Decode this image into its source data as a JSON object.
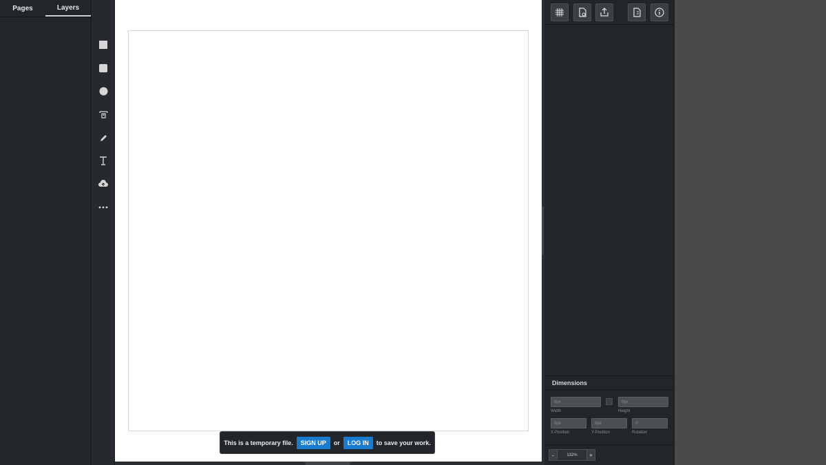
{
  "left_panel": {
    "tabs": [
      {
        "label": "Pages",
        "active": false
      },
      {
        "label": "Layers",
        "active": true
      }
    ]
  },
  "toolbar": {
    "tools": [
      "rectangle-icon",
      "rounded-rectangle-icon",
      "ellipse-icon",
      "image-icon",
      "pencil-icon",
      "text-icon",
      "upload-cloud-icon",
      "more-icon"
    ]
  },
  "toast": {
    "text_before": "This is a temporary file.",
    "signup_label": "SIGN UP",
    "or_text": "or",
    "login_label": "LOG IN",
    "text_after": "to save your work."
  },
  "right_panel": {
    "top_buttons": [
      "grid-icon",
      "page-settings-icon",
      "export-icon",
      "document-icon",
      "info-icon"
    ],
    "dimensions": {
      "title": "Dimensions",
      "width": {
        "value": "0px",
        "label": "Width"
      },
      "height": {
        "value": "0px",
        "label": "Height"
      },
      "x": {
        "value": "0px",
        "label": "X-Position"
      },
      "y": {
        "value": "0px",
        "label": "Y-Position"
      },
      "rotation": {
        "value": "0°",
        "label": "Rotation"
      }
    },
    "zoom": {
      "minus": "-",
      "value": "132%",
      "plus": "+"
    }
  },
  "colors": {
    "panel_bg": "#22262a",
    "accent_blue": "#1a7cd0",
    "canvas_bg": "#ffffff",
    "outer_bg": "#4a4a4a"
  }
}
